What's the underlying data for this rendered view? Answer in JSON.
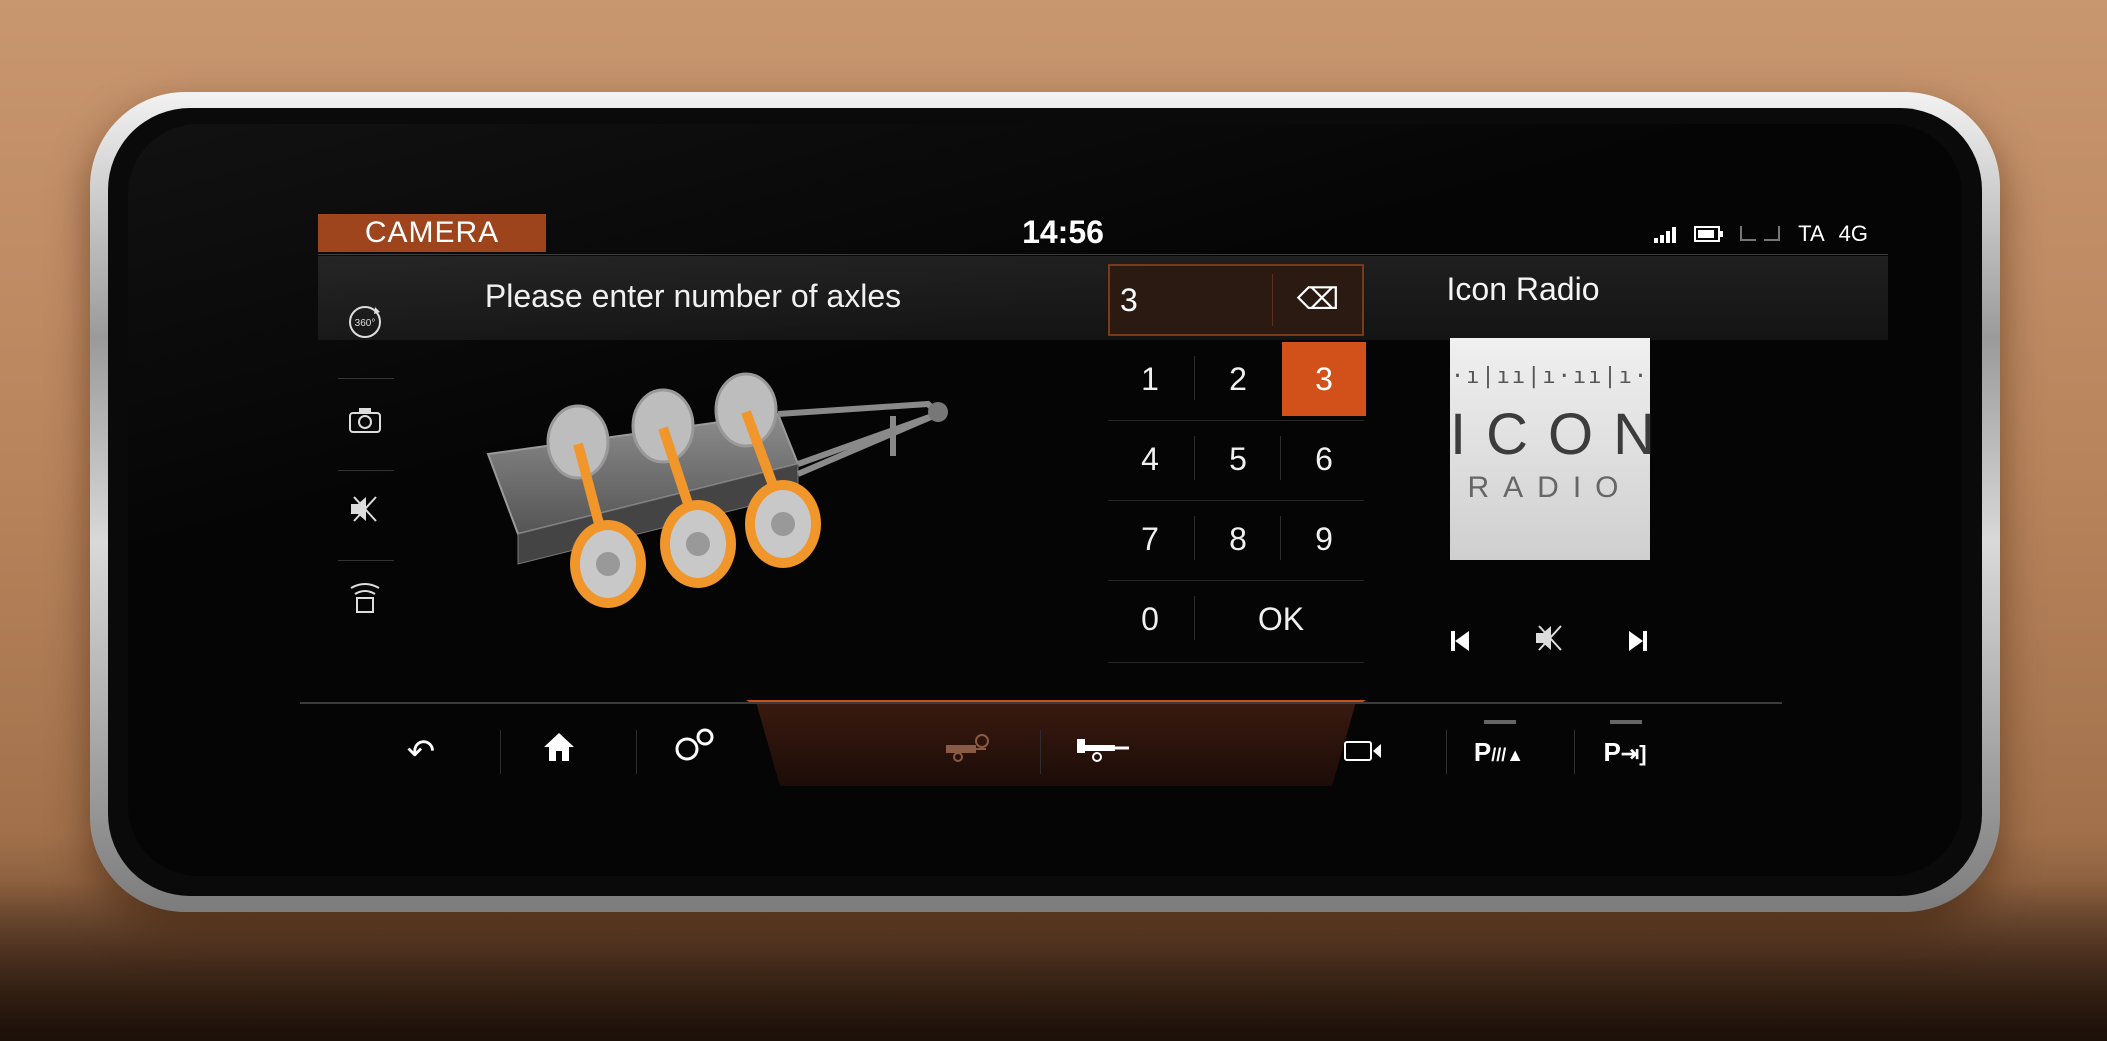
{
  "status_bar": {
    "app_tab": "CAMERA",
    "time": "14:56",
    "signal_icon": "signal-icon",
    "battery_icon": "battery-icon",
    "seat_icons": "seat-icon",
    "ta_label": "TA",
    "network_label": "4G"
  },
  "prompt": "Please enter number of axles",
  "side_menu": [
    {
      "name": "360-view-icon",
      "glyph": "360°"
    },
    {
      "name": "camera-icon",
      "glyph": "📷"
    },
    {
      "name": "mute-icon",
      "glyph": "🔇"
    },
    {
      "name": "parking-sensor-icon",
      "glyph": "⛶"
    }
  ],
  "keypad": {
    "entry_value": "3",
    "backspace_icon": "⌫",
    "keys": [
      "1",
      "2",
      "3",
      "4",
      "5",
      "6",
      "7",
      "8",
      "9",
      "0"
    ],
    "ok_label": "OK",
    "selected_key": "3"
  },
  "media": {
    "station_name": "Icon Radio",
    "logo_wave": "·ı|ıı|ı·ıı|ı·",
    "logo_line1": "ICON",
    "logo_line2": "RADIO",
    "prev_icon": "⏮",
    "mute_icon": "🔇",
    "next_icon": "⏭"
  },
  "bottom_nav": {
    "back_icon": "↶",
    "home_icon": "⌂",
    "settings_icon": "⚙",
    "trailer_add_icon": "⊕",
    "trailer_icon": "⊸",
    "camera_icon": "▭◂",
    "park_assist_label": "P",
    "park_exit_label": "P"
  },
  "colors": {
    "accent": "#d2501a",
    "tab_bg": "#9b3f16",
    "trailer_accent": "#f0962a"
  }
}
